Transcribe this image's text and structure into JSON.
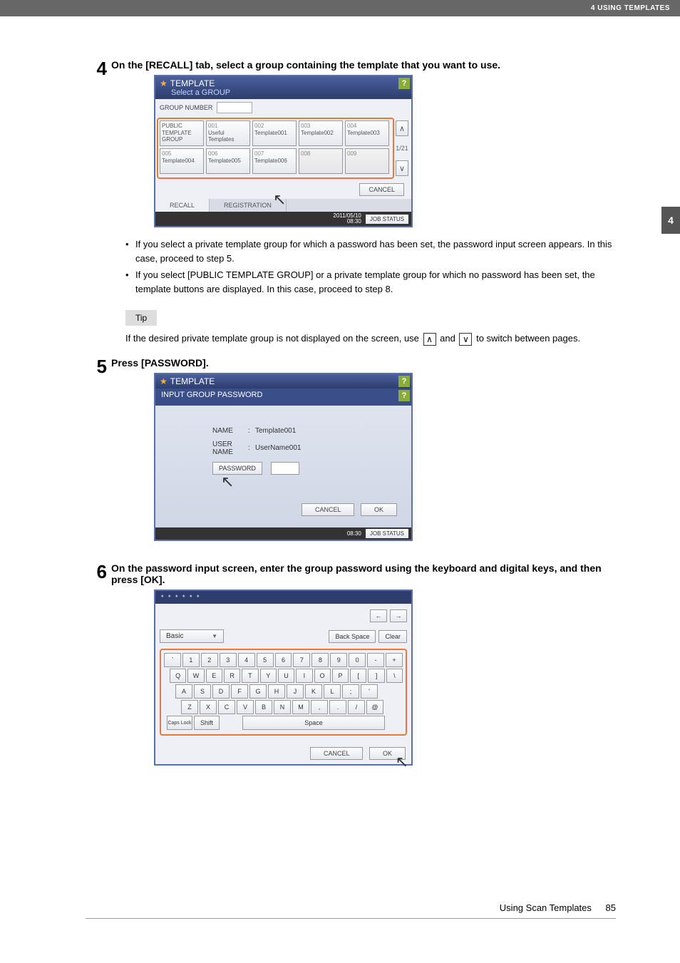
{
  "header": {
    "section": "4 USING TEMPLATES"
  },
  "sideTab": "4",
  "step4": {
    "num": "4",
    "title": "On the [RECALL] tab, select a group containing the template that you want to use.",
    "bullets": [
      "If you select a private template group for which a password has been set, the password input screen appears. In this case, proceed to step 5.",
      "If you select [PUBLIC TEMPLATE GROUP] or a private template group for which no password has been set, the template buttons are displayed. In this case, proceed to step 8."
    ],
    "tipLabel": "Tip",
    "tipText1": "If the desired private template group is not displayed on the screen, use ",
    "tipText2": " and ",
    "tipText3": " to switch between pages."
  },
  "screen1": {
    "title": "TEMPLATE",
    "subtitle": "Select a GROUP",
    "help": "?",
    "navLabel": "GROUP NUMBER",
    "cells": [
      {
        "num": "",
        "title": "PUBLIC TEMPLATE GROUP"
      },
      {
        "num": "001",
        "title": "Useful Templates"
      },
      {
        "num": "002",
        "title": "Template001"
      },
      {
        "num": "003",
        "title": "Template002"
      },
      {
        "num": "004",
        "title": "Template003"
      },
      {
        "num": "005",
        "title": "Template004"
      },
      {
        "num": "006",
        "title": "Template005"
      },
      {
        "num": "007",
        "title": "Template006"
      },
      {
        "num": "008",
        "title": ""
      },
      {
        "num": "009",
        "title": ""
      }
    ],
    "page": "1/21",
    "cancel": "CANCEL",
    "tabs": {
      "recall": "RECALL",
      "registration": "REGISTRATION"
    },
    "footer": {
      "datetime": "2011/05/10\n08:30",
      "jobstatus": "JOB STATUS"
    }
  },
  "step5": {
    "num": "5",
    "title": "Press [PASSWORD]."
  },
  "screen2": {
    "title": "TEMPLATE",
    "subtitle": "INPUT GROUP PASSWORD",
    "help": "?",
    "nameLabel": "NAME",
    "nameValue": "Template001",
    "userLabel": "USER NAME",
    "userValue": "UserName001",
    "pwBtn": "PASSWORD",
    "cancel": "CANCEL",
    "ok": "OK",
    "footer": {
      "datetime": "08:30",
      "jobstatus": "JOB STATUS"
    }
  },
  "step6": {
    "num": "6",
    "title": "On the password input screen, enter the group password using the keyboard and digital keys, and then press [OK]."
  },
  "screen3": {
    "masked": "* * * * * *",
    "mode": "Basic",
    "backspace": "Back Space",
    "clear": "Clear",
    "row1": [
      "`",
      "1",
      "2",
      "3",
      "4",
      "5",
      "6",
      "7",
      "8",
      "9",
      "0",
      "-",
      "+"
    ],
    "row2": [
      "Q",
      "W",
      "E",
      "R",
      "T",
      "Y",
      "U",
      "I",
      "O",
      "P",
      "[",
      "]",
      "\\"
    ],
    "row3": [
      "A",
      "S",
      "D",
      "F",
      "G",
      "H",
      "J",
      "K",
      "L",
      ";",
      "'"
    ],
    "row4": [
      "Z",
      "X",
      "C",
      "V",
      "B",
      "N",
      "M",
      ",",
      ".",
      "/",
      "@"
    ],
    "caps": "Caps Lock",
    "shift": "Shift",
    "space": "Space",
    "cancel": "CANCEL",
    "ok": "OK",
    "left": "←",
    "right": "→"
  },
  "footer": {
    "text": "Using Scan Templates",
    "page": "85"
  }
}
